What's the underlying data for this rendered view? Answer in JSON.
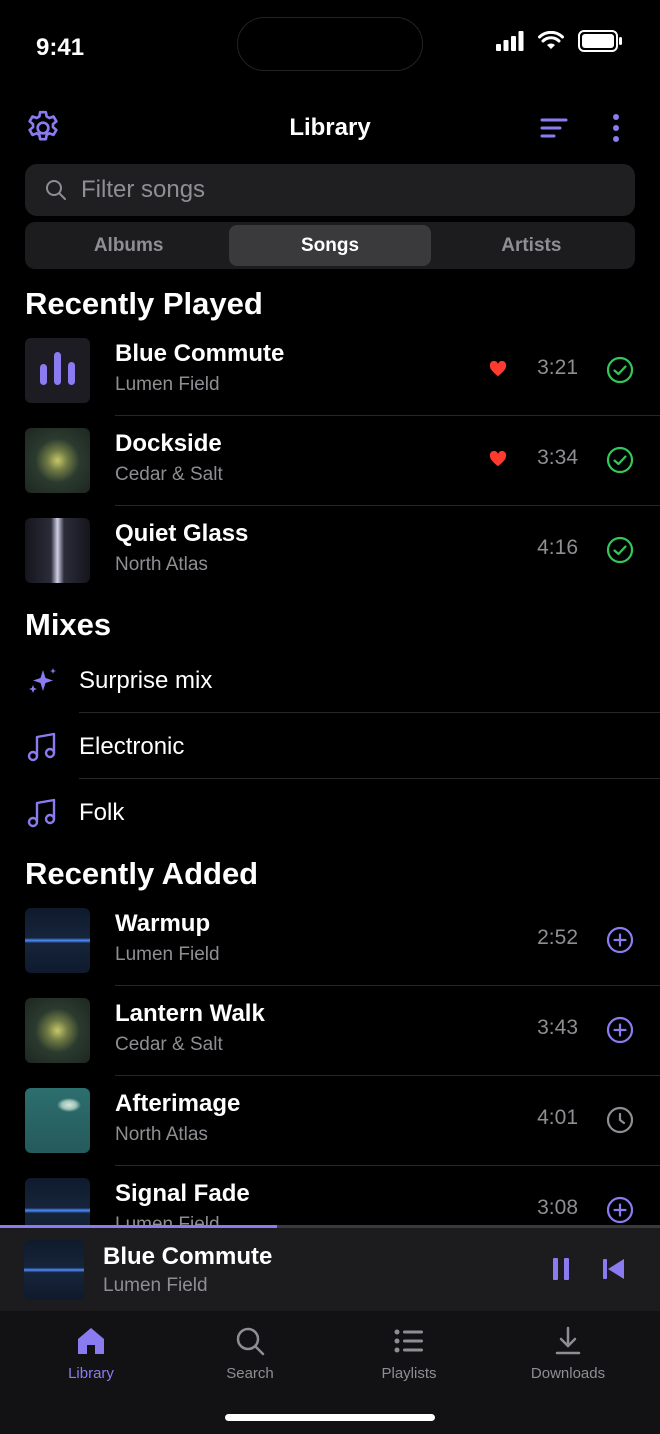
{
  "status_bar": {
    "time": "9:41"
  },
  "header": {
    "title": "Library"
  },
  "search": {
    "placeholder": "Filter songs"
  },
  "segments": [
    {
      "label": "Albums",
      "active": false
    },
    {
      "label": "Songs",
      "active": true
    },
    {
      "label": "Artists",
      "active": false
    }
  ],
  "recently_played": {
    "title": "Recently Played",
    "songs": [
      {
        "name": "Blue Commute",
        "artist": "Lumen Field",
        "duration": "3:21",
        "favorite": true,
        "status": "downloaded"
      },
      {
        "name": "Dockside",
        "artist": "Cedar & Salt",
        "duration": "3:34",
        "favorite": true,
        "status": "downloaded"
      },
      {
        "name": "Quiet Glass",
        "artist": "North Atlas",
        "duration": "4:16",
        "favorite": false,
        "status": "downloaded"
      }
    ]
  },
  "mixes": {
    "title": "Mixes",
    "items": [
      {
        "label": "Surprise mix",
        "icon": "sparkles-icon"
      },
      {
        "label": "Electronic",
        "icon": "music-note-icon"
      },
      {
        "label": "Folk",
        "icon": "music-note-icon"
      }
    ]
  },
  "recently_added": {
    "title": "Recently Added",
    "songs": [
      {
        "name": "Warmup",
        "artist": "Lumen Field",
        "duration": "2:52",
        "status": "add"
      },
      {
        "name": "Lantern Walk",
        "artist": "Cedar & Salt",
        "duration": "3:43",
        "status": "add"
      },
      {
        "name": "Afterimage",
        "artist": "North Atlas",
        "duration": "4:01",
        "status": "pending"
      },
      {
        "name": "Signal Fade",
        "artist": "Lumen Field",
        "duration": "3:08",
        "status": "add"
      }
    ]
  },
  "now_playing": {
    "name": "Blue Commute",
    "artist": "Lumen Field",
    "progress": 0.42
  },
  "tabs": [
    {
      "label": "Library",
      "icon": "home-icon",
      "active": true
    },
    {
      "label": "Search",
      "icon": "search-icon",
      "active": false
    },
    {
      "label": "Playlists",
      "icon": "list-icon",
      "active": false
    },
    {
      "label": "Downloads",
      "icon": "download-icon",
      "active": false
    }
  ],
  "colors": {
    "accent": "#8a7cf0",
    "heart": "#ff3b30",
    "downloaded": "#34c759",
    "muted": "#8e8e93"
  }
}
